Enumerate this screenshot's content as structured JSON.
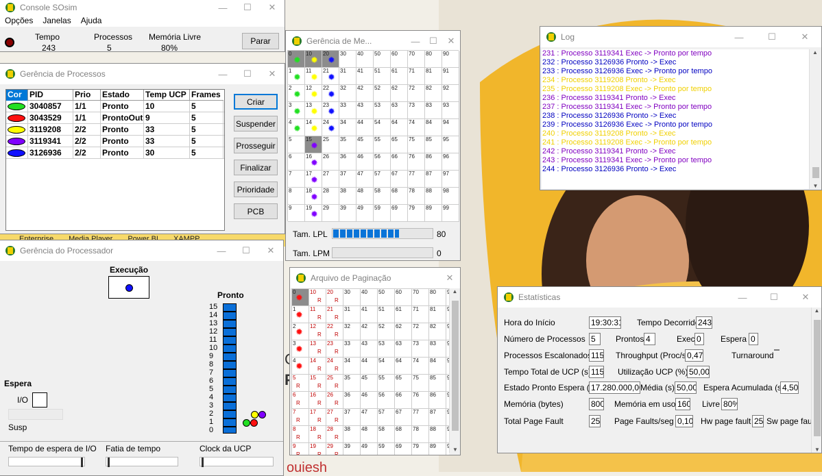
{
  "colors": {
    "green": "#22e022",
    "red": "#ff1010",
    "yellow": "#ffff00",
    "purple": "#8000ff",
    "blue": "#1010ff",
    "logBlue": "#0000c0",
    "logYellow": "#f0d000",
    "logPurple": "#8000c0",
    "progress": "#0a74d8"
  },
  "console": {
    "title": "Console SOsim",
    "menu": [
      "Opções",
      "Janelas",
      "Ajuda"
    ],
    "tempo_label": "Tempo",
    "tempo_value": "243",
    "processos_label": "Processos",
    "processos_value": "5",
    "memoria_label": "Memória Livre",
    "memoria_value": "80%",
    "parar": "Parar"
  },
  "processes": {
    "title": "Gerência de Processos",
    "columns": [
      "Cor",
      "PID",
      "Prio",
      "Estado",
      "Temp UCP",
      "Frames"
    ],
    "rows": [
      {
        "color": "green",
        "pid": "3040857",
        "prio": "1/1",
        "estado": "Pronto",
        "ucp": "10",
        "frames": "5"
      },
      {
        "color": "red",
        "pid": "3043529",
        "prio": "1/1",
        "estado": "ProntoOut",
        "ucp": "9",
        "frames": "5"
      },
      {
        "color": "yellow",
        "pid": "3119208",
        "prio": "2/2",
        "estado": "Pronto",
        "ucp": "33",
        "frames": "5"
      },
      {
        "color": "purple",
        "pid": "3119341",
        "prio": "2/2",
        "estado": "Pronto",
        "ucp": "33",
        "frames": "5"
      },
      {
        "color": "blue",
        "pid": "3126936",
        "prio": "2/2",
        "estado": "Pronto",
        "ucp": "30",
        "frames": "5"
      }
    ],
    "buttons": [
      "Criar",
      "Suspender",
      "Prosseguir",
      "Finalizar",
      "Prioridade",
      "PCB"
    ]
  },
  "taskbar": [
    "Enterprise",
    "Media Player",
    "Power BI",
    "XAMPP"
  ],
  "processor": {
    "title": "Gerência do Processador",
    "execucao": "Execução",
    "pronto": "Pronto",
    "espera": "Espera",
    "io": "I/O",
    "susp": "Susp",
    "levels": [
      "15",
      "14",
      "13",
      "12",
      "11",
      "10",
      "9",
      "8",
      "7",
      "6",
      "5",
      "4",
      "3",
      "2",
      "1",
      "0"
    ],
    "io_wait": "Tempo de espera de I/O",
    "fatia": "Fatia de tempo",
    "clock": "Clock da UCP"
  },
  "memory": {
    "title": "Gerência de Me...",
    "lpl_label": "Tam. LPL",
    "lpl_value": "80",
    "lpm_label": "Tam. LPM",
    "lpm_value": "0",
    "lpl_fill": 0.8,
    "lpm_fill": 0
  },
  "paging": {
    "title": "Arquivo de Paginação",
    "r": "R"
  },
  "log": {
    "title": "Log",
    "lines": [
      {
        "t": "231 : Processo 3119341 Exec -> Pronto por tempo",
        "c": "purple"
      },
      {
        "t": "232 : Processo 3126936 Pronto -> Exec",
        "c": "blue"
      },
      {
        "t": "233 : Processo 3126936 Exec -> Pronto por tempo",
        "c": "blue"
      },
      {
        "t": "234 : Processo 3119208 Pronto -> Exec",
        "c": "yellow"
      },
      {
        "t": "235 : Processo 3119208 Exec -> Pronto por tempo",
        "c": "yellow"
      },
      {
        "t": "236 : Processo 3119341 Pronto -> Exec",
        "c": "purple"
      },
      {
        "t": "237 : Processo 3119341 Exec -> Pronto por tempo",
        "c": "purple"
      },
      {
        "t": "238 : Processo 3126936 Pronto -> Exec",
        "c": "blue"
      },
      {
        "t": "239 : Processo 3126936 Exec -> Pronto por tempo",
        "c": "blue"
      },
      {
        "t": "240 : Processo 3119208 Pronto -> Exec",
        "c": "yellow"
      },
      {
        "t": "241 : Processo 3119208 Exec -> Pronto por tempo",
        "c": "yellow"
      },
      {
        "t": "242 : Processo 3119341 Pronto -> Exec",
        "c": "purple"
      },
      {
        "t": "243 : Processo 3119341 Exec -> Pronto por tempo",
        "c": "purple"
      },
      {
        "t": "244 : Processo 3126936 Pronto -> Exec",
        "c": "blue"
      }
    ]
  },
  "stats": {
    "title": "Estatísticas",
    "hora_inicio": "Hora do Início",
    "hora_inicio_v": "19:30:31",
    "tempo_decorrido": "Tempo Decorrido",
    "tempo_decorrido_v": "243",
    "num_proc": "Número de Processos",
    "num_proc_v": "5",
    "prontos": "Prontos",
    "prontos_v": "4",
    "exec": "Exec",
    "exec_v": "0",
    "espera": "Espera",
    "espera_v": "0",
    "escalonados": "Processos Escalonados",
    "escalonados_v": "115",
    "throughput": "Throughput (Proc/s)",
    "throughput_v": "0,47",
    "turnaround": "Turnaround",
    "turnaround_v": "",
    "tempo_ucp": "Tempo Total de UCP (s)",
    "tempo_ucp_v": "115",
    "util_ucp": "Utilização UCP (%)",
    "util_ucp_v": "50,00",
    "pronto_espera": "Estado Pronto Espera (s)",
    "pronto_espera_v": "17.280.000,00",
    "media": "Média (s)",
    "media_v": "50,00",
    "espera_acum": "Espera Acumulada (s)",
    "espera_acum_v": "4,50",
    "memoria": "Memória (bytes)",
    "memoria_v": "800",
    "mem_uso": "Memória em uso",
    "mem_uso_v": "160",
    "livre": "Livre",
    "livre_v": "80%",
    "page_fault": "Total Page Fault",
    "page_fault_v": "25",
    "pf_seg": "Page Faults/seg",
    "pf_seg_v": "0,10",
    "hw_pf": "Hw page fault",
    "hw_pf_v": "25",
    "sw_pf": "Sw page fault"
  },
  "bg_text": [
    "C",
    "P",
    "ouiesh"
  ]
}
